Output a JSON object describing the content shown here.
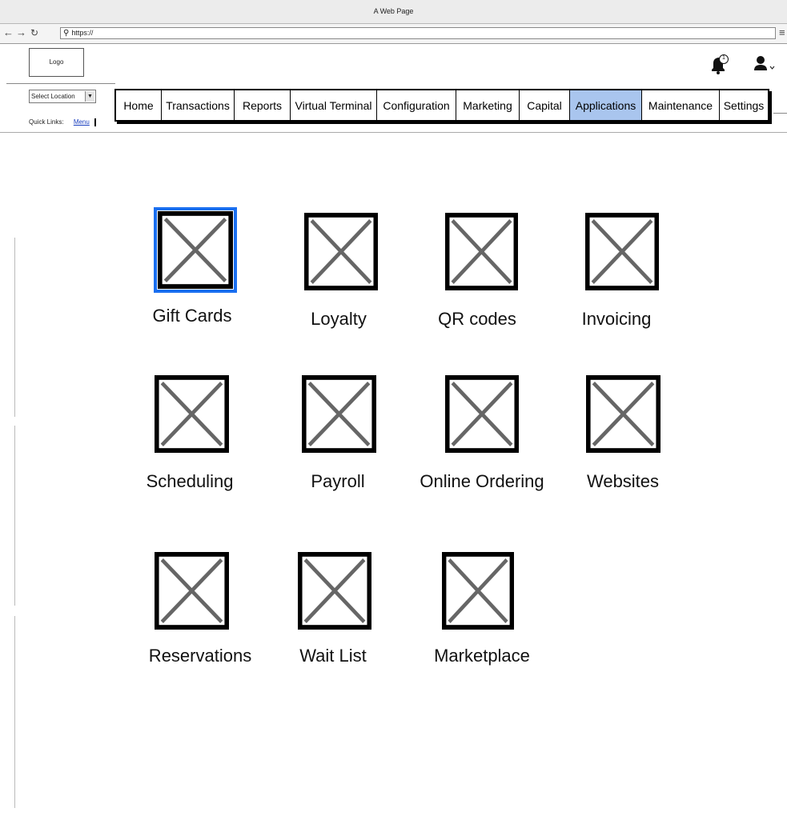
{
  "browser": {
    "window_title": "A Web Page",
    "url": "https://"
  },
  "header": {
    "logo_text": "Logo",
    "notification_count": "1"
  },
  "location": {
    "selected": "Select Location"
  },
  "quick_links": {
    "label": "Quick Links:",
    "items": [
      "Menu"
    ]
  },
  "nav": {
    "items": [
      {
        "label": "Home"
      },
      {
        "label": "Transactions"
      },
      {
        "label": "Reports"
      },
      {
        "label": "Virtual Terminal"
      },
      {
        "label": "Configuration"
      },
      {
        "label": "Marketing"
      },
      {
        "label": "Capital"
      },
      {
        "label": "Applications"
      },
      {
        "label": "Maintenance"
      },
      {
        "label": "Settings"
      }
    ],
    "active": "Applications",
    "active_color": "#a9c5ee"
  },
  "apps": {
    "selected": "Gift Cards",
    "selected_color": "#1a6ff0",
    "items": [
      {
        "label": "Gift Cards",
        "icon": "placeholder-image-icon"
      },
      {
        "label": "Loyalty",
        "icon": "placeholder-image-icon"
      },
      {
        "label": "QR codes",
        "icon": "placeholder-image-icon"
      },
      {
        "label": "Invoicing",
        "icon": "placeholder-image-icon"
      },
      {
        "label": "Scheduling",
        "icon": "placeholder-image-icon"
      },
      {
        "label": "Payroll",
        "icon": "placeholder-image-icon"
      },
      {
        "label": "Online Ordering",
        "icon": "placeholder-image-icon"
      },
      {
        "label": "Websites",
        "icon": "placeholder-image-icon"
      },
      {
        "label": "Reservations",
        "icon": "placeholder-image-icon"
      },
      {
        "label": "Wait List",
        "icon": "placeholder-image-icon"
      },
      {
        "label": "Marketplace",
        "icon": "placeholder-image-icon"
      }
    ]
  }
}
